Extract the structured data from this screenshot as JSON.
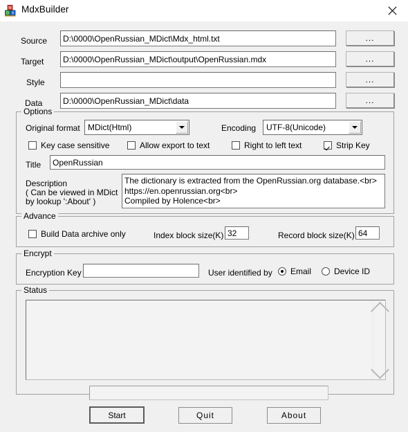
{
  "window": {
    "title": "MdxBuilder",
    "icon": "mdx-blocks-icon",
    "close_label": "✕"
  },
  "paths": {
    "browse_label": "...",
    "rows": [
      {
        "label": "Source",
        "value": "D:\\0000\\OpenRussian_MDict\\Mdx_html.txt",
        "placeholder": ""
      },
      {
        "label": "Target",
        "value": "D:\\0000\\OpenRussian_MDict\\output\\OpenRussian.mdx",
        "placeholder": ""
      },
      {
        "label": "Style",
        "value": "",
        "placeholder": ""
      },
      {
        "label": "Data",
        "value": "D:\\0000\\OpenRussian_MDict\\data",
        "placeholder": ""
      }
    ]
  },
  "options": {
    "group_title": "Options",
    "original_format": {
      "label": "Original format",
      "value": "MDict(Html)"
    },
    "encoding": {
      "label": "Encoding",
      "value": "UTF-8(Unicode)"
    },
    "checkboxes": [
      {
        "label": "Key case sensitive",
        "checked": false
      },
      {
        "label": "Allow export to text",
        "checked": false
      },
      {
        "label": "Right to left text",
        "checked": false
      },
      {
        "label": "Strip Key",
        "checked": true
      }
    ],
    "title_field": {
      "label": "Title",
      "value": "OpenRussian"
    },
    "description": {
      "label_line1": "Description",
      "label_line2": "( Can be viewed in MDict",
      "label_line3": "by lookup ':About' )",
      "value": "The dictionary is extracted from the OpenRussian.org database.<br>\nhttps://en.openrussian.org<br>\nCompiled by Holence<br>"
    }
  },
  "advance": {
    "group_title": "Advance",
    "build_data_archive_only": {
      "label": "Build Data archive only",
      "checked": false
    },
    "index_block_size": {
      "label": "Index block size(K)",
      "value": "32"
    },
    "record_block_size": {
      "label": "Record block size(K)",
      "value": "64"
    }
  },
  "encrypt": {
    "group_title": "Encrypt",
    "encryption_key": {
      "label": "Encryption Key",
      "value": "",
      "placeholder": ""
    },
    "user_identified_by": {
      "label": "User identified by"
    },
    "radios": [
      {
        "label": "Email",
        "selected": true
      },
      {
        "label": "Device ID",
        "selected": false
      }
    ]
  },
  "status": {
    "group_title": "Status",
    "log": "",
    "progress_text": ""
  },
  "actions": [
    {
      "label": "Start",
      "default": true
    },
    {
      "label": "Quit",
      "default": false
    },
    {
      "label": "About",
      "default": false
    }
  ],
  "colors": {
    "window_bg": "#f0f0f0",
    "titlebar_bg": "#ffffff",
    "field_bg": "#ffffff",
    "border": "#a0a0a0",
    "text": "#000000"
  }
}
